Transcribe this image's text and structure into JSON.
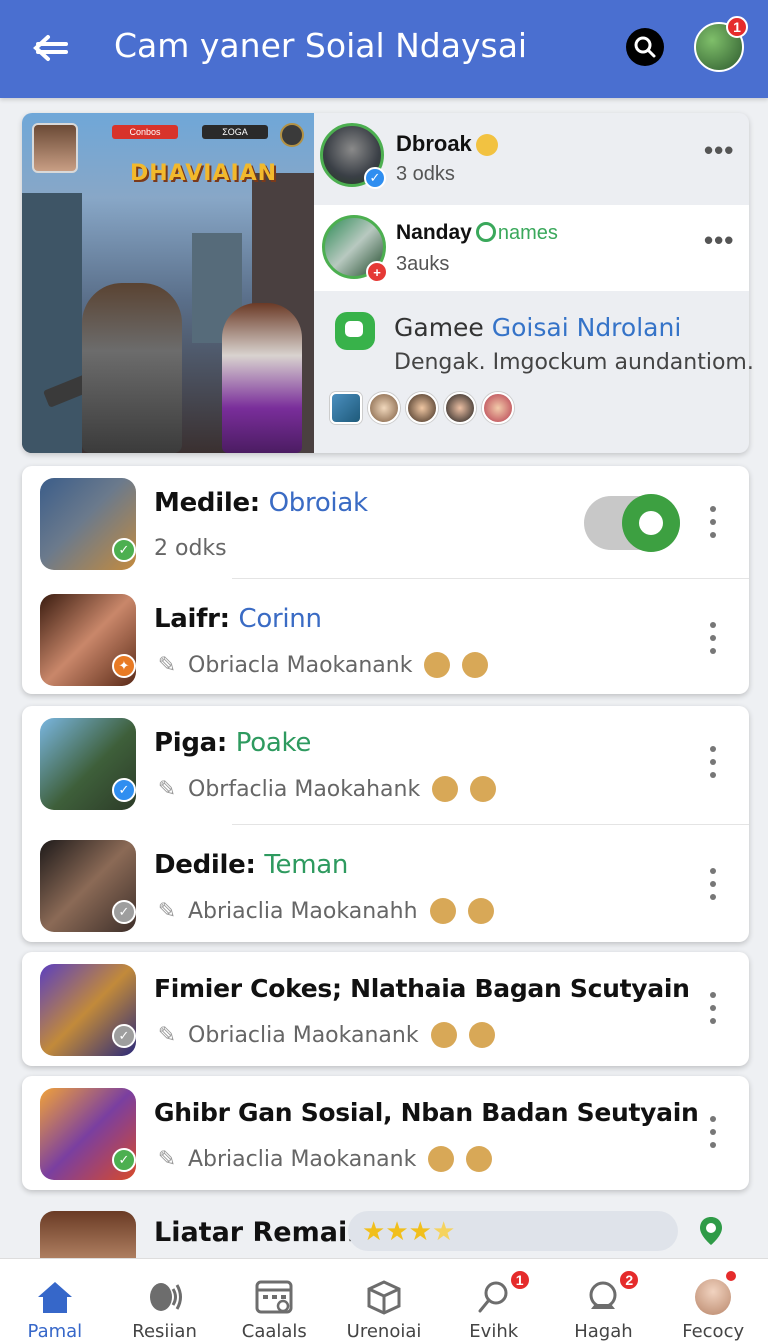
{
  "header": {
    "title": "Cam yaner Soial Ndaysai",
    "notification_count": "1"
  },
  "feature": {
    "hud_left": "Conbos",
    "hud_right": "ΣOGA",
    "game_logo": "DHAVIAIAN",
    "posts": [
      {
        "name": "Dbroak",
        "sub": "3 odks"
      },
      {
        "name": "Nanday",
        "tag": "names",
        "sub": "3auks"
      }
    ],
    "game_title_prefix": "Gamee",
    "game_title_highlight": "Goisai Ndrolani",
    "game_desc": "Dengak. Imgockum aundantiom."
  },
  "list": [
    {
      "label": "Medile:",
      "value": "Obroiak",
      "value_color": "#3a6bc4",
      "sub": "2 odks",
      "has_toggle": true,
      "toggle_on": true
    },
    {
      "label": "Laifr:",
      "value": "Corinn",
      "value_color": "#3a6bc4",
      "sub": "Obriacla Maokanank"
    },
    {
      "label": "Piga:",
      "value": "Poake",
      "value_color": "#2e9a5f",
      "sub": "Obrfaclia Maokahank"
    },
    {
      "label": "Dedile:",
      "value": "Teman",
      "value_color": "#2e9a5f",
      "sub": "Abriaclia Maokanahh"
    },
    {
      "label": "Fimier Cokes; Nlathaia Bagan Scutyain",
      "value": "",
      "value_color": "#111",
      "sub": "Obriaclia Maokanank"
    },
    {
      "label": "Ghibr Gan Sosial, Nban Badan Seutyain",
      "value": "",
      "value_color": "#111",
      "sub": "Abriaclia Maokanank"
    }
  ],
  "last_row": {
    "title": "Liatar Remain",
    "rating": 3.5
  },
  "nav": [
    {
      "label": "Pamal",
      "icon": "home-icon",
      "active": true
    },
    {
      "label": "Resiian",
      "icon": "megaphone-icon"
    },
    {
      "label": "Caalals",
      "icon": "calendar-icon"
    },
    {
      "label": "Urenoiai",
      "icon": "box-icon"
    },
    {
      "label": "Evihk",
      "icon": "pin-search-icon",
      "badge": "1"
    },
    {
      "label": "Hagah",
      "icon": "chat-bubble-icon",
      "badge": "2"
    },
    {
      "label": "Fecocy",
      "icon": "profile-avatar"
    }
  ]
}
